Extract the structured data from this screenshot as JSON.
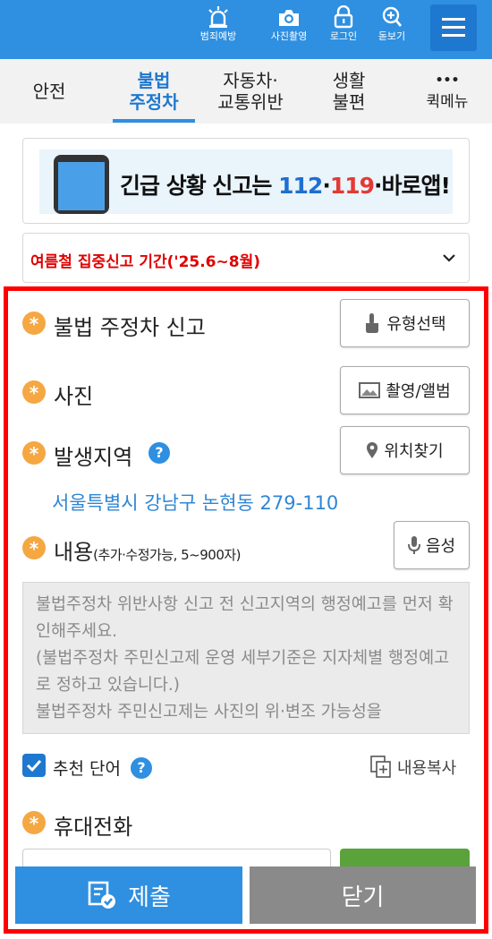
{
  "topbar": {
    "items": [
      {
        "label": "범죄예방",
        "icon": "siren-icon"
      },
      {
        "label": "사진촬영",
        "icon": "camera-icon"
      },
      {
        "label": "로그인",
        "icon": "lock-icon"
      },
      {
        "label": "돋보기",
        "icon": "zoom-in-icon"
      }
    ],
    "menu_icon": "hamburger-menu-icon"
  },
  "tabs": [
    {
      "line1": "안전",
      "line2": ""
    },
    {
      "line1": "불법",
      "line2": "주정차",
      "active": true
    },
    {
      "line1": "자동차·",
      "line2": "교통위반"
    },
    {
      "line1": "생활",
      "line2": "불편"
    },
    {
      "line1": "•••",
      "line2": "퀵메뉴"
    }
  ],
  "banner": {
    "text_prefix": "긴급 상황 신고는 ",
    "n112": "112",
    "dot1": "·",
    "n119": "119",
    "suffix": "·바로앱!"
  },
  "notice": {
    "text": "여름철 집중신고 기간('25.6~8월)"
  },
  "form": {
    "title": "불법 주정차 신고",
    "type_button": "유형선택",
    "photo_label": "사진",
    "photo_button": "촬영/앨범",
    "location_label": "발생지역",
    "location_button": "위치찾기",
    "address": "서울특별시 강남구 논현동 279-110",
    "content_label": "내용",
    "content_hint": "(추가·수정가능, 5~900자)",
    "voice_button": "음성",
    "content_placeholder": "불법주정차 위반사항 신고 전 신고지역의 행정예고를 먼저 확인해주세요.\n(불법주정차 주민신고제 운영 세부기준은 지자체별 행정예고로 정하고 있습니다.)\n불법주정차 주민신고제는 사진의 위·변조 가능성을",
    "recommend_label": "추천 단어",
    "recommend_checked": true,
    "copy_label": "내용복사",
    "phone_label": "휴대전화",
    "submit": "제출",
    "close": "닫기"
  },
  "colors": {
    "primary": "#2f8fe0",
    "required": "#f5a742",
    "alert": "#e00000",
    "highlight_border": "#ff0000"
  }
}
